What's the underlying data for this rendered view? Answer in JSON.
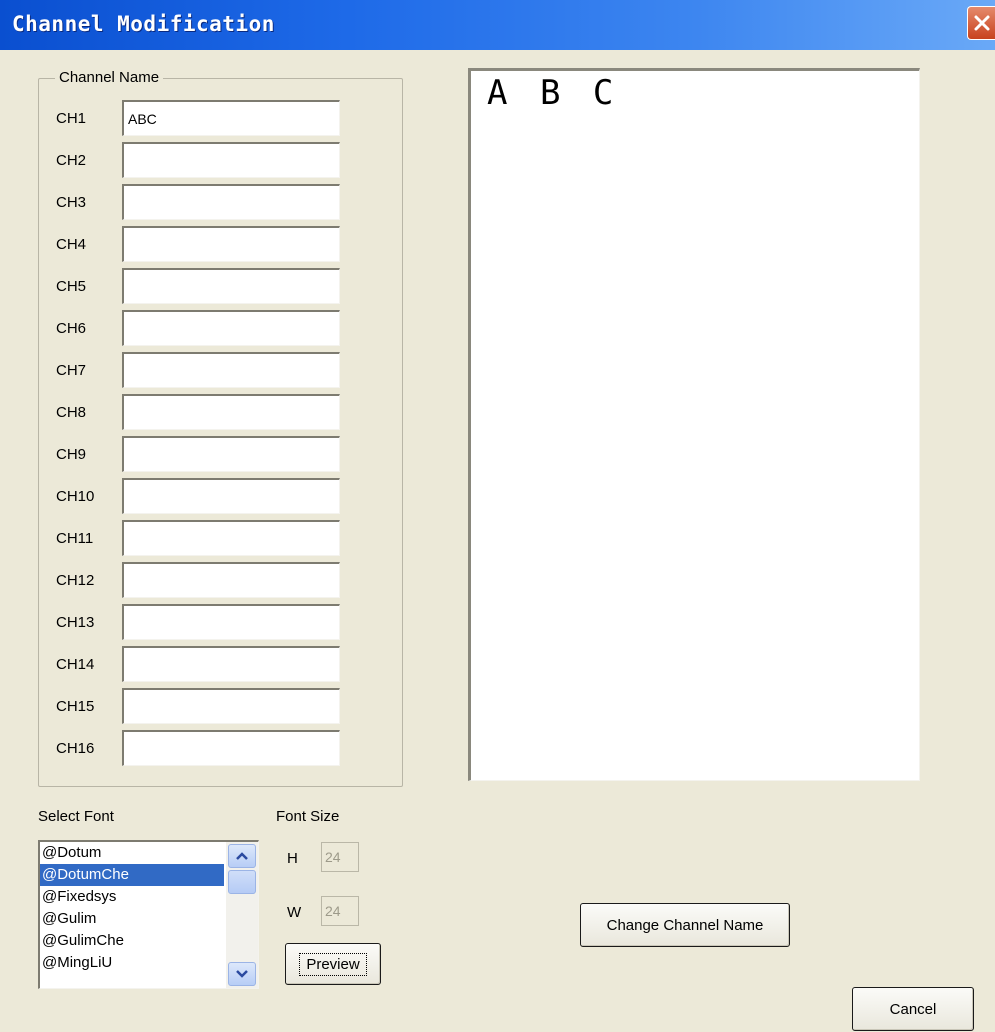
{
  "window": {
    "title": "Channel Modification"
  },
  "channel_group": {
    "legend": "Channel Name",
    "channels": [
      {
        "label": "CH1",
        "value": "ABC"
      },
      {
        "label": "CH2",
        "value": ""
      },
      {
        "label": "CH3",
        "value": ""
      },
      {
        "label": "CH4",
        "value": ""
      },
      {
        "label": "CH5",
        "value": ""
      },
      {
        "label": "CH6",
        "value": ""
      },
      {
        "label": "CH7",
        "value": ""
      },
      {
        "label": "CH8",
        "value": ""
      },
      {
        "label": "CH9",
        "value": ""
      },
      {
        "label": "CH10",
        "value": ""
      },
      {
        "label": "CH11",
        "value": ""
      },
      {
        "label": "CH12",
        "value": ""
      },
      {
        "label": "CH13",
        "value": ""
      },
      {
        "label": "CH14",
        "value": ""
      },
      {
        "label": "CH15",
        "value": ""
      },
      {
        "label": "CH16",
        "value": ""
      }
    ]
  },
  "preview": {
    "text": "ABC"
  },
  "font_select": {
    "label": "Select Font",
    "items": [
      "@Dotum",
      "@DotumChe",
      "@Fixedsys",
      "@Gulim",
      "@GulimChe",
      "@MingLiU"
    ],
    "selected": "@DotumChe"
  },
  "font_size": {
    "label": "Font Size",
    "h_label": "H",
    "h_value": "24",
    "w_label": "W",
    "w_value": "24"
  },
  "buttons": {
    "preview": "Preview",
    "change": "Change Channel Name",
    "cancel": "Cancel"
  },
  "colors": {
    "titlebar": "#1e6ae8",
    "dialog_bg": "#ece9d8",
    "selection": "#316ac5"
  }
}
